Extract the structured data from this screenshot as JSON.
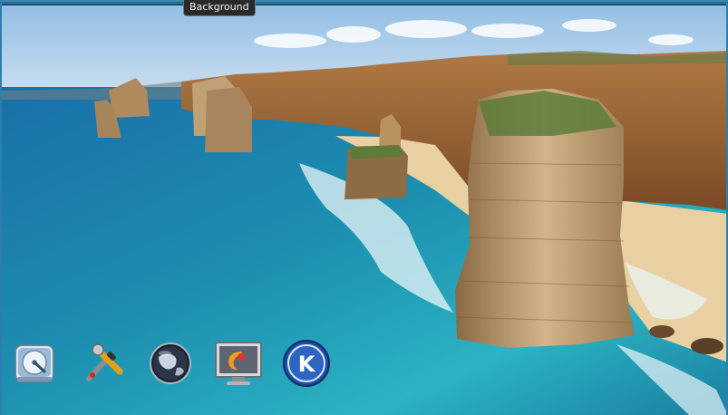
{
  "tooltip": {
    "text": "Background"
  },
  "desktop_icons": [
    {
      "name": "harddisk-icon"
    },
    {
      "name": "tools-icon"
    },
    {
      "name": "globe-icon"
    },
    {
      "name": "monitor-settings-icon"
    },
    {
      "name": "kde-menu-icon"
    }
  ],
  "colors": {
    "sky_top": "#9ec5e6",
    "sea_deep": "#0e5b86",
    "sea_shallow": "#2fb2c4",
    "cliff": "#a8743f",
    "sand": "#ead2a6"
  }
}
